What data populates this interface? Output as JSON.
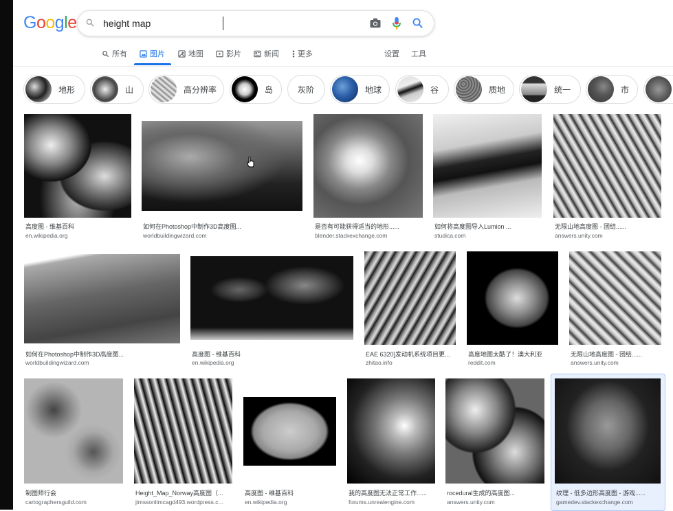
{
  "search": {
    "query": "height map",
    "logo": {
      "letters": [
        "G",
        "o",
        "o",
        "g",
        "l",
        "e"
      ],
      "colors": [
        "#4285f4",
        "#ea4335",
        "#fbbc05",
        "#4285f4",
        "#34a853",
        "#ea4335"
      ]
    }
  },
  "tabs": {
    "items": [
      {
        "label": "所有",
        "icon": "search-icon"
      },
      {
        "label": "图片",
        "icon": "image-icon"
      },
      {
        "label": "地图",
        "icon": "map-icon"
      },
      {
        "label": "影片",
        "icon": "video-icon"
      },
      {
        "label": "新闻",
        "icon": "news-icon"
      },
      {
        "label": "更多",
        "icon": "more-icon"
      }
    ],
    "active_index": 1,
    "settings": "设置",
    "tools": "工具"
  },
  "chips": [
    {
      "label": "地形"
    },
    {
      "label": "山"
    },
    {
      "label": "高分辨率"
    },
    {
      "label": "岛"
    },
    {
      "label": "灰阶"
    },
    {
      "label": "地球"
    },
    {
      "label": "谷"
    },
    {
      "label": "质地"
    },
    {
      "label": "统一"
    },
    {
      "label": "市"
    },
    {
      "label": ""
    }
  ],
  "results": [
    [
      {
        "title": "高度图 - 维基百科",
        "source": "en.wikipedia.org"
      },
      {
        "title": "如何在Photoshop中制作3D高度图...",
        "source": "worldbuildingwizard.com"
      },
      {
        "title": "是否有可能获得适当的地形......",
        "source": "blender.stackexchange.com"
      },
      {
        "title": "如何将高度图导入Lumion ...",
        "source": "studica.com"
      },
      {
        "title": "无限山地高度图 - 团结......",
        "source": "answers.unity.com"
      }
    ],
    [
      {
        "title": "如何在Photoshop中制作3D高度图...",
        "source": "worldbuildingwizard.com"
      },
      {
        "title": "高度图 - 维基百科",
        "source": "en.wikipedia.org"
      },
      {
        "title": "EAE 6320]发动机系统项目更...",
        "source": "zhitao.info"
      },
      {
        "title": "高度地图太酷了！澳大利亚",
        "source": "reddit.com"
      },
      {
        "title": "无限山地高度图 - 团结......",
        "source": "answers.unity.com"
      }
    ],
    [
      {
        "title": "制图师行会",
        "source": "cartographersguild.com"
      },
      {
        "title": "Height_Map_Norway高度图（...",
        "source": "jimssonlimcagd493.wordpress.c..."
      },
      {
        "title": "高度图 - 维基百科",
        "source": "en.wikipedia.org"
      },
      {
        "title": "我的高度图无法正常工作......",
        "source": "forums.unrealengine.com"
      },
      {
        "title": "rocedural生成的高度图...",
        "source": "answers.unity.com"
      },
      {
        "title": "纹理 - 低多边形高度图 - 游戏......",
        "source": "gamedev.stackexchange.com"
      }
    ]
  ]
}
